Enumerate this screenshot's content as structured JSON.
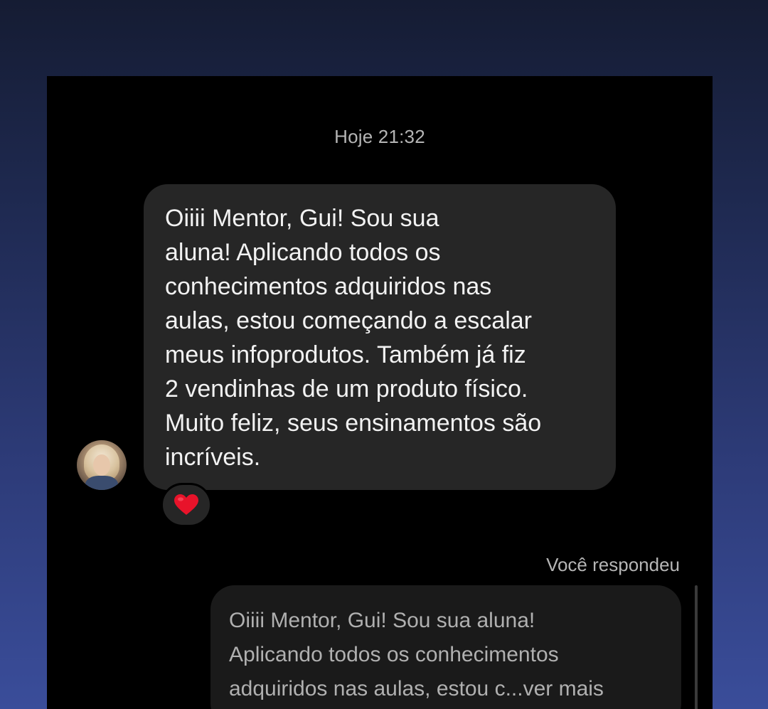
{
  "chat": {
    "timestamp": "Hoje 21:32",
    "incoming_message": {
      "lines": [
        "Oiiii Mentor, Gui! Sou sua",
        "aluna! Aplicando todos os",
        "conhecimentos adquiridos nas",
        "aulas, estou começando a escalar",
        "meus infoprodutos. Também já fiz",
        "2 vendinhas de um produto físico.",
        "Muito feliz, seus ensinamentos são",
        "incríveis."
      ],
      "reaction": "heart-emoji",
      "avatar": "sender-avatar"
    },
    "reply": {
      "label": "Você respondeu",
      "quoted_lines": [
        "Oiiii Mentor, Gui! Sou sua aluna!",
        "Aplicando todos os conhecimentos",
        "adquiridos nas aulas, estou c...ver mais"
      ]
    }
  },
  "colors": {
    "screen_background": "#000000",
    "incoming_bubble": "#262626",
    "quoted_bubble": "#1a1a1a",
    "heart": "#e8132a"
  }
}
